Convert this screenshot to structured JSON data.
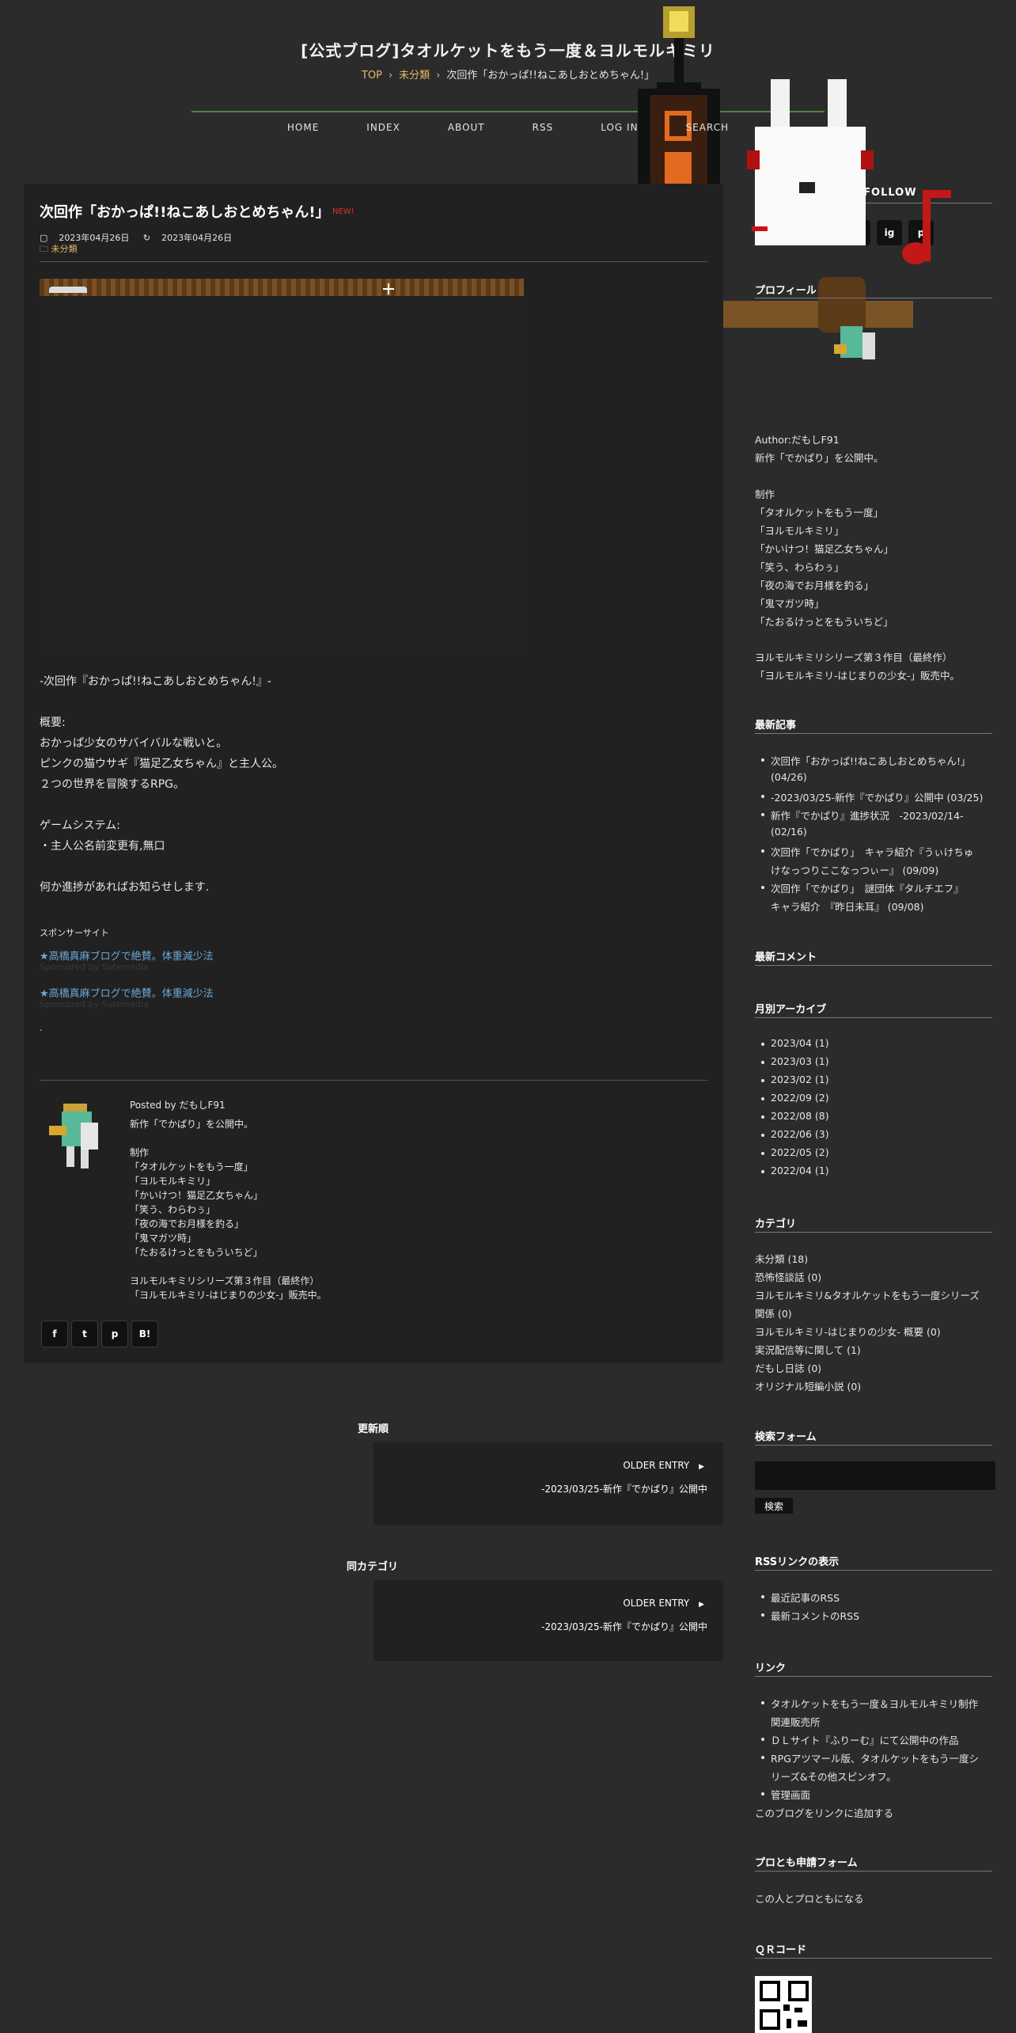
{
  "site": {
    "title": "[公式ブログ]タオルケットをもう一度＆ヨルモルキミリ",
    "breadcrumb": {
      "top": "TOP",
      "sep": "›",
      "category": "未分類",
      "current": "次回作「おかっぱ!!ねこあしおとめちゃん!」"
    },
    "nav": [
      "HOME",
      "INDEX",
      "ABOUT",
      "RSS",
      "LOG IN",
      "SEARCH"
    ]
  },
  "article": {
    "title": "次回作「おかっぱ!!ねこあしおとめちゃん!」",
    "badge": "NEW!",
    "posted": "2023年04月26日",
    "updated": "2023年04月26日",
    "category": "未分類",
    "body": [
      "-次回作『おかっぱ!!ねこあしおとめちゃん!』-",
      "概要:",
      "おかっぱ少女のサバイバルな戦いと。",
      "ピンクの猫ウサギ『猫足乙女ちゃん』と主人公。",
      "２つの世界を冒険するRPG。",
      "ゲームシステム:",
      "・主人公名前変更有,無口",
      "何か進捗があればお知らせします."
    ],
    "sponsor_title": "スポンサーサイト",
    "sponsor_links": [
      "★高橋真麻ブログで絶賛。体重減少法",
      "★高橋真麻ブログで絶賛。体重減少法"
    ],
    "sponsor_subs": [
      "Sponsored by Sutemedia",
      "Sponsored by Sutemedia"
    ],
    "dot": "."
  },
  "author_box": {
    "posted_by": "Posted by だもしF91",
    "lines": [
      "新作「でかぱり」を公開中。",
      "",
      "制作",
      "「タオルケットをもう一度」",
      "「ヨルモルキミリ」",
      "「かいけつ！猫足乙女ちゃん」",
      "「笑う、わらわぅ」",
      "「夜の海でお月様を釣る」",
      "「鬼マガツ時」",
      "「たおるけっとをもういちど」",
      "",
      "ヨルモルキミリシリーズ第３作目（最終作）",
      "「ヨルモルキミリ-はじまりの少女-」販売中。"
    ]
  },
  "share": [
    "f",
    "t",
    "p",
    "B!"
  ],
  "entry_nav": {
    "newer_label": "更新順",
    "older_label": "OLDER ENTRY",
    "older_title": "-2023/03/25-新作『でかぱり』公開中",
    "same_cat_label": "同カテゴリ",
    "same_cat_older": "OLDER ENTRY",
    "same_cat_title": "-2023/03/25-新作『でかぱり』公開中"
  },
  "sidebar": {
    "subscribe_title": "SUBSCRIBE AND FOLLOW",
    "social": [
      "f",
      "t",
      "ig",
      "p"
    ],
    "profile_title": "プロフィール",
    "profile": [
      "Author:だもしF91",
      "新作「でかぱり」を公開中。",
      "",
      "制作",
      "「タオルケットをもう一度」",
      "「ヨルモルキミリ」",
      "「かいけつ！猫足乙女ちゃん」",
      "「笑う、わらわぅ」",
      "「夜の海でお月様を釣る」",
      "「鬼マガツ時」",
      "「たおるけっとをもういちど」",
      "",
      "ヨルモルキミリシリーズ第３作目（最終作）",
      "「ヨルモルキミリ-はじまりの少女-」販売中。"
    ],
    "recent_title": "最新記事",
    "recent": [
      [
        "次回作「おかっぱ!!ねこあしおとめちゃん!」",
        "(04/26)"
      ],
      [
        "-2023/03/25-新作『でかぱり』公開中 (03/25)",
        ""
      ],
      [
        "新作『でかぱり』進捗状況　-2023/02/14-",
        "(02/16)"
      ],
      [
        "次回作「でかぱり」　キャラ紹介『うぃけちゅ",
        "けなっつりここなっつぃー』 (09/09)"
      ],
      [
        "次回作「でかぱり」　謎団体『タルチエフ』",
        "キャラ紹介　『昨日未耳』 (09/08)"
      ]
    ],
    "comments_title": "最新コメント",
    "archive_title": "月別アーカイブ",
    "archive": [
      "2023/04 (1)",
      "2023/03 (1)",
      "2023/02 (1)",
      "2022/09 (2)",
      "2022/08 (8)",
      "2022/06 (3)",
      "2022/05 (2)",
      "2022/04 (1)"
    ],
    "category_title": "カテゴリ",
    "categories": [
      "未分類 (18)",
      "恐怖怪談話 (0)",
      "ヨルモルキミリ&タオルケットをもう一度シリーズ",
      "関係 (0)",
      "ヨルモルキミリ-はじまりの少女- 概要 (0)",
      "実況配信等に関して (1)",
      "だもし日誌 (0)",
      "オリジナル短編小説 (0)"
    ],
    "search_title": "検索フォーム",
    "search_button": "検索",
    "rss_title": "RSSリンクの表示",
    "rss": [
      "最近記事のRSS",
      "最新コメントのRSS"
    ],
    "links_title": "リンク",
    "links": [
      [
        "タオルケットをもう一度＆ヨルモルキミリ制作",
        "関連販売所"
      ],
      [
        "ＤＬサイト『ふりーむ』にて公開中の作品",
        ""
      ],
      [
        "RPGアツマール版、タオルケットをもう一度シ",
        "リーズ&その他スピンオフ。"
      ],
      [
        "管理画面",
        ""
      ]
    ],
    "add_link": "このブログをリンクに追加する",
    "friend_title": "プロとも申請フォーム",
    "friend_link": "この人とプロともになる",
    "qr_title": "ＱＲコード"
  },
  "colors": {
    "background": "#2b2b2b",
    "panel": "#212121",
    "accent_link": "#e8b96a",
    "sponsor": "#6aa9d8",
    "badge": "#e0302a",
    "rule": "#4a8a3a"
  }
}
